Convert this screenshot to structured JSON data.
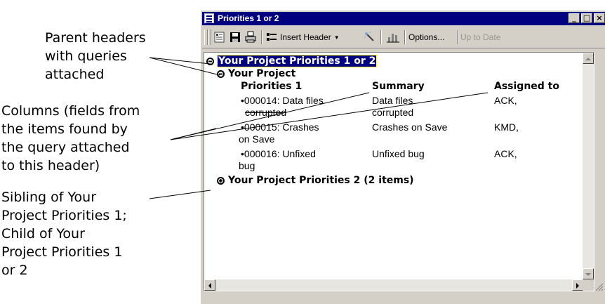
{
  "callouts": {
    "parent_headers": "Parent headers\nwith queries\nattached",
    "columns": "Columns (fields from\nthe items found by\nthe query attached\nto this header)",
    "sibling": "Sibling of Your\nProject Priorities 1;\nChild of Your\nProject Priorities 1\nor 2"
  },
  "window": {
    "title": "Priorities 1 or 2",
    "buttons": {
      "minimize": "_",
      "maximize": "□",
      "close": "×"
    }
  },
  "toolbar": {
    "insert_header": "Insert Header",
    "options": "Options...",
    "up_to_date": "Up to Date"
  },
  "tree": {
    "root": "Your Project Priorities 1 or 2",
    "child": "Your Project",
    "sibling": "Your Project Priorities 2 (2 items)",
    "columns": [
      "Priorities 1",
      "Summary",
      "Assigned to"
    ],
    "rows": [
      {
        "id": "•000014: Data files",
        "id2": "corrupted",
        "summary": "Data files",
        "summary2": "corrupted",
        "assigned": "ACK,"
      },
      {
        "id": "•000015: Crashes",
        "id2": "on Save",
        "summary": "Crashes on Save",
        "summary2": "",
        "assigned": "KMD,"
      },
      {
        "id": "•000016: Unfixed",
        "id2": "bug",
        "summary": "Unfixed bug",
        "summary2": "",
        "assigned": "ACK,"
      }
    ]
  },
  "colors": {
    "titlebar": "#000080",
    "face": "#d4d0c8",
    "selection": "#000080"
  },
  "icons": [
    "app-icon",
    "toolbar-doc-icon",
    "save-icon",
    "print-icon",
    "insert-header-icon",
    "wand-icon",
    "chart-icon",
    "expand-icon",
    "collapse-icon"
  ]
}
